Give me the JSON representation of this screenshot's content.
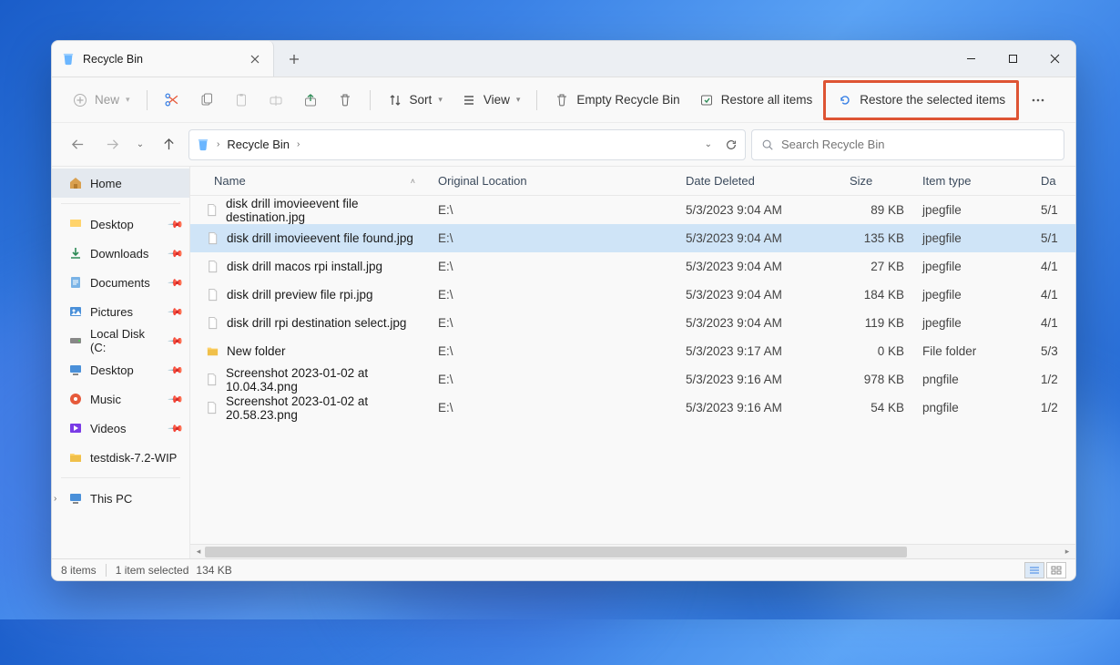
{
  "tab": {
    "title": "Recycle Bin"
  },
  "toolbar": {
    "new": "New",
    "sort": "Sort",
    "view": "View",
    "empty": "Empty Recycle Bin",
    "restore_all": "Restore all items",
    "restore_selected": "Restore the selected items"
  },
  "address": {
    "location": "Recycle Bin"
  },
  "search": {
    "placeholder": "Search Recycle Bin"
  },
  "sidebar": {
    "home": "Home",
    "items": [
      {
        "label": "Desktop",
        "icon": "desktop"
      },
      {
        "label": "Downloads",
        "icon": "download"
      },
      {
        "label": "Documents",
        "icon": "document"
      },
      {
        "label": "Pictures",
        "icon": "pictures"
      },
      {
        "label": "Local Disk (C:",
        "icon": "disk"
      },
      {
        "label": "Desktop",
        "icon": "desktop-blue"
      },
      {
        "label": "Music",
        "icon": "music"
      },
      {
        "label": "Videos",
        "icon": "video"
      },
      {
        "label": "testdisk-7.2-WIP",
        "icon": "folder",
        "nopin": true
      }
    ],
    "thispc": "This PC"
  },
  "columns": {
    "name": "Name",
    "orig": "Original Location",
    "date": "Date Deleted",
    "size": "Size",
    "type": "Item type",
    "datec": "Da"
  },
  "rows": [
    {
      "name": "disk drill imovieevent file destination.jpg",
      "orig": "E:\\",
      "date": "5/3/2023 9:04 AM",
      "size": "89 KB",
      "type": "jpegfile",
      "datec": "5/1",
      "icon": "file"
    },
    {
      "name": "disk drill imovieevent file found.jpg",
      "orig": "E:\\",
      "date": "5/3/2023 9:04 AM",
      "size": "135 KB",
      "type": "jpegfile",
      "datec": "5/1",
      "icon": "file",
      "selected": true
    },
    {
      "name": "disk drill macos rpi install.jpg",
      "orig": "E:\\",
      "date": "5/3/2023 9:04 AM",
      "size": "27 KB",
      "type": "jpegfile",
      "datec": "4/1",
      "icon": "file"
    },
    {
      "name": "disk drill preview file rpi.jpg",
      "orig": "E:\\",
      "date": "5/3/2023 9:04 AM",
      "size": "184 KB",
      "type": "jpegfile",
      "datec": "4/1",
      "icon": "file"
    },
    {
      "name": "disk drill rpi destination select.jpg",
      "orig": "E:\\",
      "date": "5/3/2023 9:04 AM",
      "size": "119 KB",
      "type": "jpegfile",
      "datec": "4/1",
      "icon": "file"
    },
    {
      "name": "New folder",
      "orig": "E:\\",
      "date": "5/3/2023 9:17 AM",
      "size": "0 KB",
      "type": "File folder",
      "datec": "5/3",
      "icon": "folder"
    },
    {
      "name": "Screenshot 2023-01-02 at 10.04.34.png",
      "orig": "E:\\",
      "date": "5/3/2023 9:16 AM",
      "size": "978 KB",
      "type": "pngfile",
      "datec": "1/2",
      "icon": "file"
    },
    {
      "name": "Screenshot 2023-01-02 at 20.58.23.png",
      "orig": "E:\\",
      "date": "5/3/2023 9:16 AM",
      "size": "54 KB",
      "type": "pngfile",
      "datec": "1/2",
      "icon": "file"
    }
  ],
  "status": {
    "count": "8 items",
    "selected": "1 item selected",
    "size": "134 KB"
  }
}
